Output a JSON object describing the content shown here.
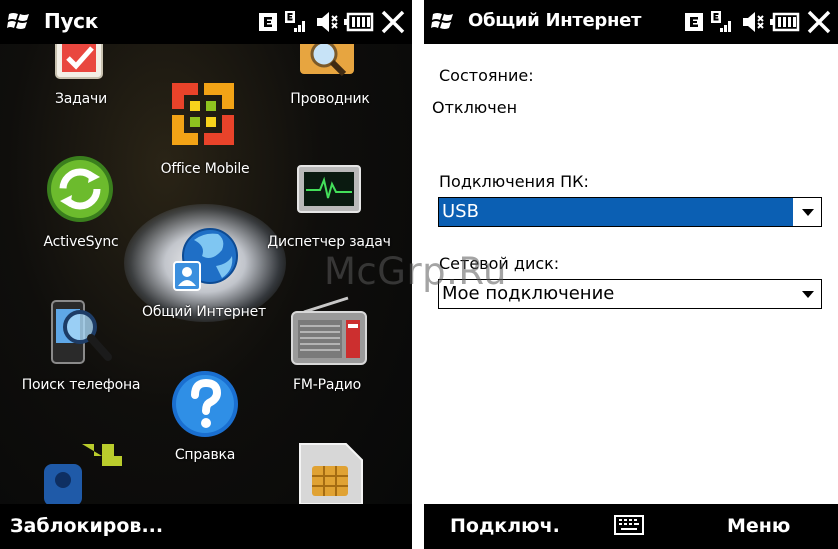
{
  "left": {
    "title": "Пуск",
    "softkey_left": "Заблокиров...",
    "items": [
      {
        "label": "Задачи",
        "icon": "tasks-icon"
      },
      {
        "label": "Office Mobile",
        "icon": "office-icon"
      },
      {
        "label": "Проводник",
        "icon": "explorer-icon"
      },
      {
        "label": "ActiveSync",
        "icon": "activesync-icon"
      },
      {
        "label": "Диспетчер задач",
        "icon": "task-manager-icon"
      },
      {
        "label": "Общий Интернет",
        "icon": "internet-sharing-icon"
      },
      {
        "label": "Поиск телефона",
        "icon": "phone-search-icon"
      },
      {
        "label": "FM-Радио",
        "icon": "fm-radio-icon"
      },
      {
        "label": "Справка",
        "icon": "help-icon"
      }
    ]
  },
  "right": {
    "title": "Общий Интернет",
    "status_label": "Состояние:",
    "status_value": "Отключен",
    "pc_connection_label": "Подключения ПК:",
    "pc_connection_value": "USB",
    "network_label": "Сетевой диск:",
    "network_value": "Мое подключение",
    "softkey_left": "Подключ.",
    "softkey_right": "Меню"
  },
  "watermark": "McGrp.Ru",
  "colors": {
    "selection": "#0b5fb3",
    "bar": "#000000"
  }
}
